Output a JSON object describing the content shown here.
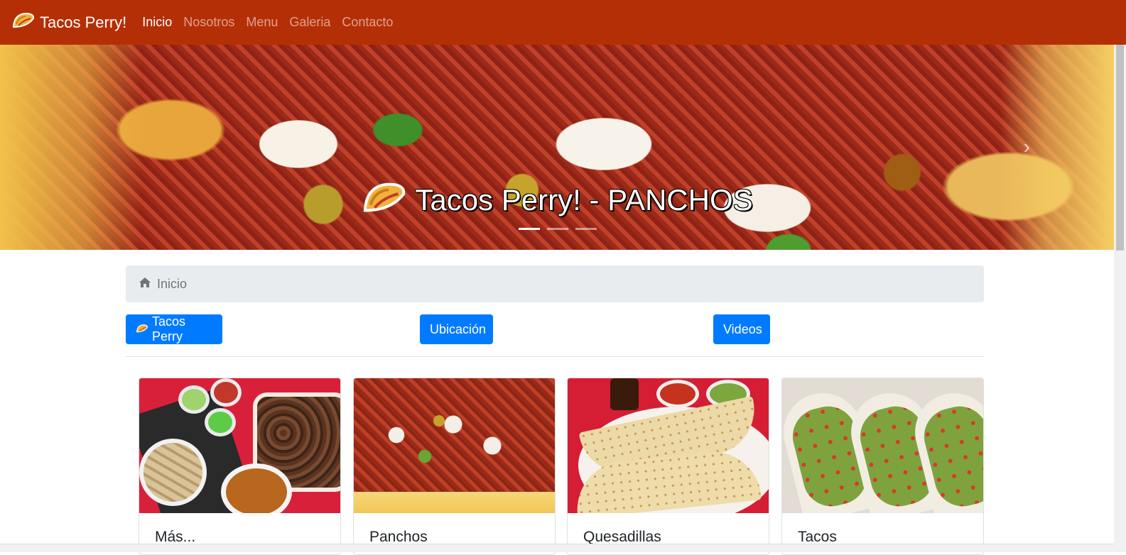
{
  "navbar": {
    "brand": "Tacos Perry!",
    "links": [
      {
        "label": "Inicio",
        "active": true
      },
      {
        "label": "Nosotros",
        "active": false
      },
      {
        "label": "Menu",
        "active": false
      },
      {
        "label": "Galeria",
        "active": false
      },
      {
        "label": "Contacto",
        "active": false
      }
    ],
    "bg_color": "#b52f06"
  },
  "hero": {
    "title": "Tacos Perry! - PANCHOS",
    "indicators": 3,
    "active_indicator": 0
  },
  "breadcrumb": {
    "icon": "home-icon",
    "current": "Inicio"
  },
  "buttons": {
    "tacos": "Tacos Perry",
    "ubicacion": "Ubicación",
    "videos": "Videos",
    "color": "#007bff"
  },
  "cards": [
    {
      "title": "Más..."
    },
    {
      "title": "Panchos"
    },
    {
      "title": "Quesadillas"
    },
    {
      "title": "Tacos"
    }
  ]
}
